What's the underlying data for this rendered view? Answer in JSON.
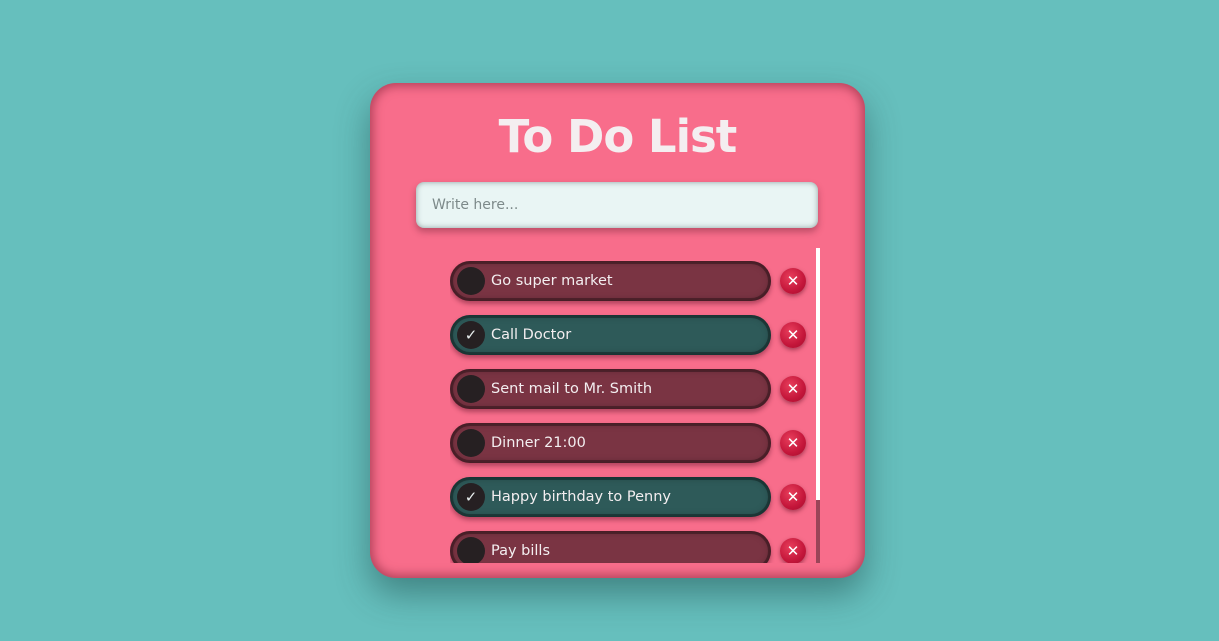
{
  "app": {
    "title": "To Do List",
    "input": {
      "placeholder": "Write here...",
      "value": ""
    }
  },
  "tasks": [
    {
      "label": "Go super market",
      "done": false
    },
    {
      "label": "Call Doctor",
      "done": true
    },
    {
      "label": "Sent mail to Mr. Smith",
      "done": false
    },
    {
      "label": "Dinner 21:00",
      "done": false
    },
    {
      "label": "Happy birthday to Penny",
      "done": true
    },
    {
      "label": "Pay bills",
      "done": false
    }
  ],
  "icons": {
    "check": "check-icon",
    "delete": "close-icon"
  },
  "colors": {
    "background": "#66bfbd",
    "card": "#f86d8b",
    "pending_item": "#7a3443",
    "done_item": "#2e5a59",
    "delete_button": "#c4163a"
  }
}
